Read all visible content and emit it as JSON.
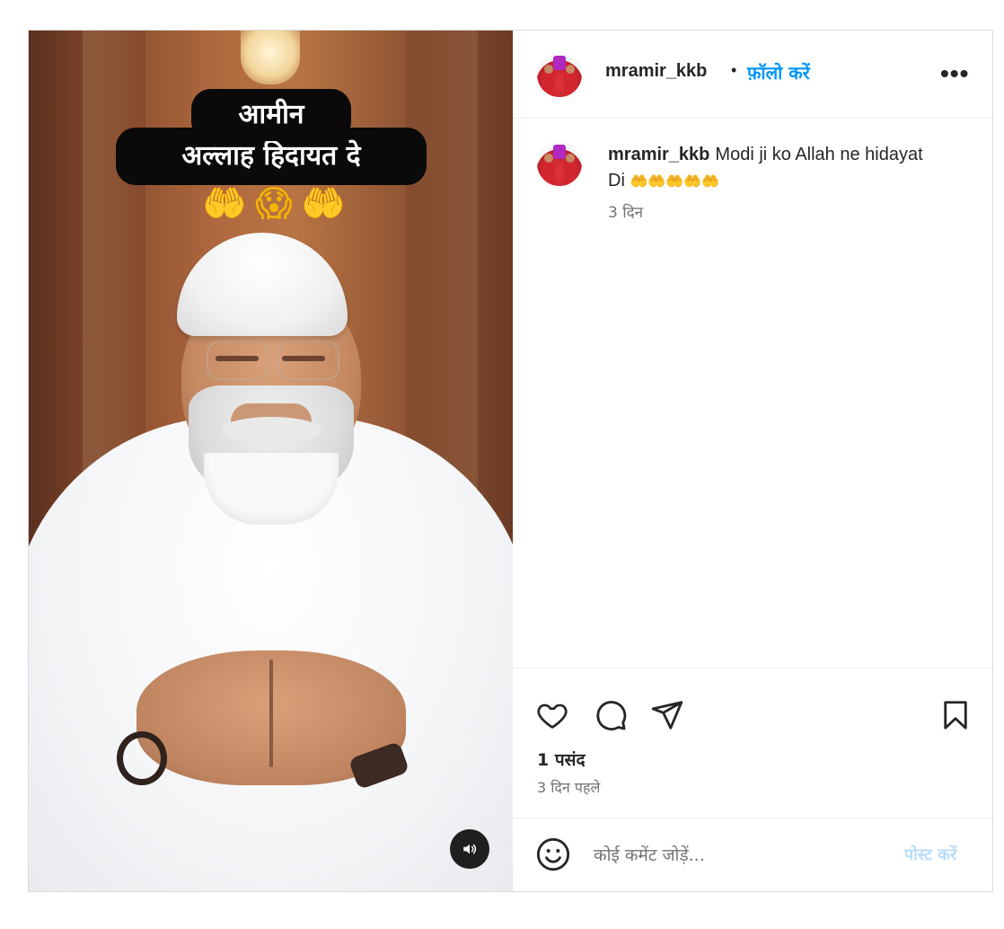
{
  "media": {
    "caption_line1": "आमीन",
    "caption_line2": "अल्लाह हिदायत दे",
    "emoji_left": "🤲",
    "emoji_center": "😱",
    "emoji_right": "🤲",
    "sound_icon": "speaker-icon"
  },
  "header": {
    "username": "mramir_kkb",
    "separator": "•",
    "follow_label": "फ़ॉलो करें",
    "more_icon": "more-options-icon",
    "more_label": "•••"
  },
  "caption": {
    "username": "mramir_kkb",
    "text": "Modi ji ko Allah ne hidayat Di",
    "emojis": "🤲🤲🤲🤲🤲",
    "time": "3 दिन"
  },
  "actions": {
    "like_icon": "heart-icon",
    "comment_icon": "comment-icon",
    "share_icon": "send-icon",
    "save_icon": "bookmark-icon",
    "likes": "1 पसंद",
    "posted": "3 दिन पहले"
  },
  "add_comment": {
    "emoji_icon": "smiley-icon",
    "placeholder": "कोई कमेंट जोड़ें...",
    "post_label": "पोस्ट करें"
  },
  "colors": {
    "accent": "#0095f6",
    "post_disabled": "#b8dcfb",
    "muted": "#737373",
    "border": "#dbdbdb"
  }
}
